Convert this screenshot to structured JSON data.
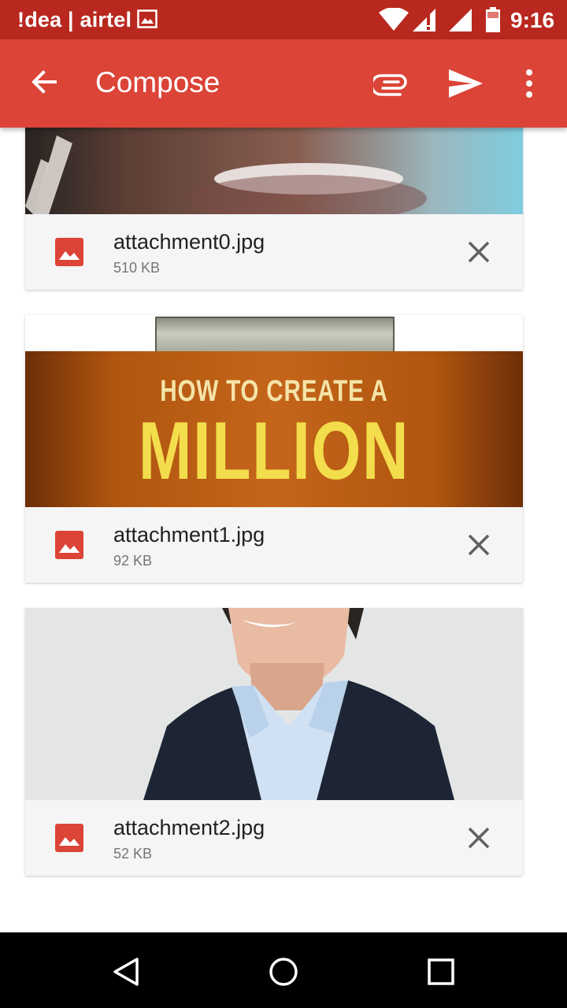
{
  "status_bar": {
    "carrier": "!dea | airtel",
    "time": "9:16"
  },
  "app_bar": {
    "title": "Compose",
    "back_icon": "arrow-back-icon",
    "attach_icon": "paperclip-icon",
    "send_icon": "send-icon",
    "more_icon": "more-vert-icon"
  },
  "attachments": [
    {
      "name": "attachment0.jpg",
      "size": "510 KB"
    },
    {
      "name": "attachment1.jpg",
      "size": "92 KB",
      "thumb_text_top": "HOW TO CREATE A",
      "thumb_text_main": "MILLION"
    },
    {
      "name": "attachment2.jpg",
      "size": "52 KB"
    }
  ],
  "colors": {
    "status_bar": "#b9281f",
    "app_bar": "#db4437",
    "file_icon": "#db4437"
  },
  "nav_bar": {
    "back_icon": "nav-back-icon",
    "home_icon": "nav-home-icon",
    "recents_icon": "nav-recents-icon"
  }
}
